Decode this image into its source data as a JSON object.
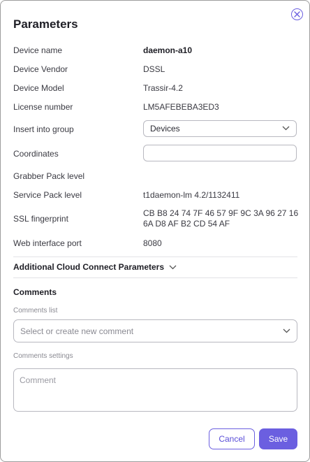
{
  "dialog": {
    "title": "Parameters",
    "close_icon": "close-circle-icon"
  },
  "fields": {
    "device_name": {
      "label": "Device name",
      "value": "daemon-a10"
    },
    "device_vendor": {
      "label": "Device Vendor",
      "value": "DSSL"
    },
    "device_model": {
      "label": "Device Model",
      "value": "Trassir-4.2"
    },
    "license_number": {
      "label": "License number",
      "value": "LM5AFEBEBA3ED3"
    },
    "insert_group": {
      "label": "Insert into group",
      "value": "Devices"
    },
    "coordinates": {
      "label": "Coordinates",
      "value": ""
    },
    "grabber_pack": {
      "label": "Grabber Pack level",
      "value": ""
    },
    "service_pack": {
      "label": "Service Pack level",
      "value": "t1daemon-lm 4.2/1132411"
    },
    "ssl_fingerprint": {
      "label": "SSL fingerprint",
      "value": "CB B8 24 74 7F 46 57 9F 9C 3A 96 27 16 6A D8 AF B2 CD 54 AF"
    },
    "web_port": {
      "label": "Web interface port",
      "value": "8080"
    }
  },
  "cloud_section": {
    "label": "Additional Cloud Connect Parameters"
  },
  "comments": {
    "heading": "Comments",
    "list_label": "Comments list",
    "list_placeholder": "Select or create new comment",
    "settings_label": "Comments settings",
    "comment_placeholder": "Comment"
  },
  "buttons": {
    "cancel": "Cancel",
    "save": "Save"
  },
  "colors": {
    "accent": "#6b5fe0"
  }
}
